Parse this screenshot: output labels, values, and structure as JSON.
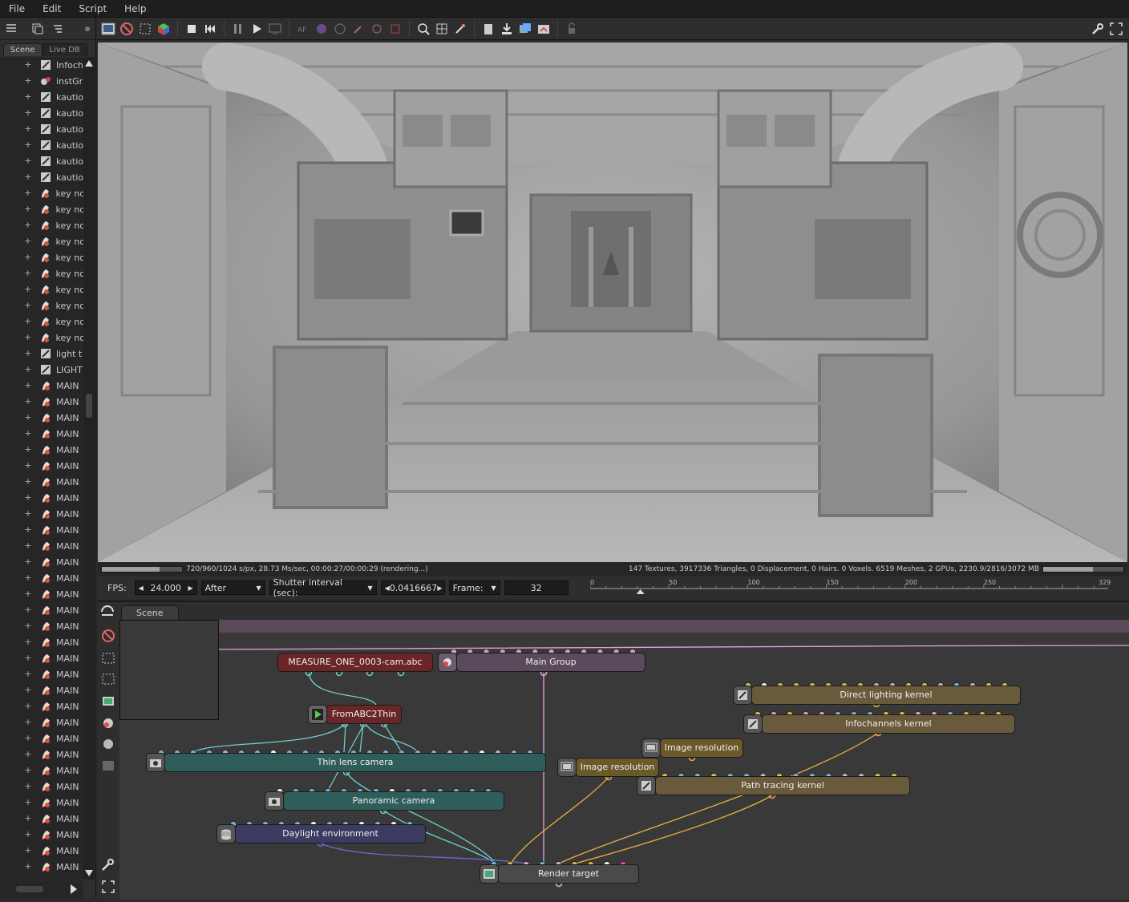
{
  "menu": [
    "File",
    "Edit",
    "Script",
    "Help"
  ],
  "left_panel": {
    "tabs": [
      "Scene",
      "Live DB"
    ],
    "tree": [
      {
        "label": "Infoch",
        "icon": "kernel-icon"
      },
      {
        "label": "instGr",
        "icon": "geometry-icon"
      },
      {
        "label": "kautio",
        "icon": "kernel-icon"
      },
      {
        "label": "kautio",
        "icon": "kernel-icon"
      },
      {
        "label": "kautio",
        "icon": "kernel-icon"
      },
      {
        "label": "kautio",
        "icon": "kernel-icon"
      },
      {
        "label": "kautio",
        "icon": "kernel-icon"
      },
      {
        "label": "kautio",
        "icon": "kernel-icon"
      },
      {
        "label": "key no",
        "icon": "material-icon"
      },
      {
        "label": "key no",
        "icon": "material-icon"
      },
      {
        "label": "key no",
        "icon": "material-icon"
      },
      {
        "label": "key no",
        "icon": "material-icon"
      },
      {
        "label": "key no",
        "icon": "material-icon"
      },
      {
        "label": "key no",
        "icon": "material-icon"
      },
      {
        "label": "key no",
        "icon": "material-icon"
      },
      {
        "label": "key no",
        "icon": "material-icon"
      },
      {
        "label": "key no",
        "icon": "material-icon"
      },
      {
        "label": "key no",
        "icon": "material-icon"
      },
      {
        "label": "light t",
        "icon": "kernel-icon"
      },
      {
        "label": "LIGHT",
        "icon": "kernel-icon"
      },
      {
        "label": "MAIN",
        "icon": "material-icon"
      },
      {
        "label": "MAIN",
        "icon": "material-icon"
      },
      {
        "label": "MAIN",
        "icon": "material-icon"
      },
      {
        "label": "MAIN",
        "icon": "material-icon"
      },
      {
        "label": "MAIN",
        "icon": "material-icon"
      },
      {
        "label": "MAIN",
        "icon": "material-icon"
      },
      {
        "label": "MAIN",
        "icon": "material-icon"
      },
      {
        "label": "MAIN",
        "icon": "material-icon"
      },
      {
        "label": "MAIN",
        "icon": "material-icon"
      },
      {
        "label": "MAIN",
        "icon": "material-icon"
      },
      {
        "label": "MAIN",
        "icon": "material-icon"
      },
      {
        "label": "MAIN",
        "icon": "material-icon"
      },
      {
        "label": "MAIN",
        "icon": "material-icon"
      },
      {
        "label": "MAIN",
        "icon": "material-icon"
      },
      {
        "label": "MAIN",
        "icon": "material-icon"
      },
      {
        "label": "MAIN",
        "icon": "material-icon"
      },
      {
        "label": "MAIN",
        "icon": "material-icon"
      },
      {
        "label": "MAIN",
        "icon": "material-icon"
      },
      {
        "label": "MAIN",
        "icon": "material-icon"
      },
      {
        "label": "MAIN",
        "icon": "material-icon"
      },
      {
        "label": "MAIN",
        "icon": "material-icon"
      },
      {
        "label": "MAIN",
        "icon": "material-icon"
      },
      {
        "label": "MAIN",
        "icon": "material-icon"
      },
      {
        "label": "MAIN",
        "icon": "material-icon"
      },
      {
        "label": "MAIN",
        "icon": "material-icon"
      },
      {
        "label": "MAIN",
        "icon": "material-icon"
      },
      {
        "label": "MAIN",
        "icon": "material-icon"
      },
      {
        "label": "MAIN",
        "icon": "material-icon"
      },
      {
        "label": "MAIN",
        "icon": "material-icon"
      },
      {
        "label": "MAIN",
        "icon": "material-icon"
      },
      {
        "label": "MAIN",
        "icon": "material-icon"
      }
    ]
  },
  "status": {
    "render_progress": 0.72,
    "gpu_progress": 0.62,
    "left_text": "720/960/1024 s/px, 28.73 Ms/sec, 00:00:27/00:00:29 (rendering...)",
    "right_text": "147 Textures, 3917336 Triangles, 0 Displacement, 0 Hairs. 0 Voxels. 6519 Meshes, 2 GPUs, 2230.9/2816/3072 MB"
  },
  "timeline": {
    "fps_label": "FPS:",
    "fps_value": "24.000",
    "after_mode": "After",
    "shutter_label": "Shutter interval (sec):",
    "shutter_value": "0.0416667",
    "frame_label": "Frame:",
    "frame_value": "32",
    "ruler_ticks": [
      "0",
      "50",
      "100",
      "150",
      "200",
      "250",
      "329"
    ],
    "current_frame_fraction": 0.097
  },
  "node_graph": {
    "tab": "Scene",
    "nodes": {
      "measure": "MEASURE_ONE_0003-cam.abc",
      "main_group": "Main Group",
      "fromabc": "FromABC2Thin",
      "thin_lens": "Thin lens camera",
      "panoramic": "Panoramic camera",
      "daylight": "Daylight environment",
      "render_target": "Render target",
      "direct_lighting": "Direct lighting kernel",
      "infochannels": "Infochannels kernel",
      "image_res_1": "Image resolution",
      "image_res_2": "Image resolution",
      "path_tracing": "Path tracing kernel"
    }
  },
  "colors": {
    "camera_node": "#2f5e5a",
    "kernel_node": "#6a5a3c",
    "group_node": "#5a4a5c",
    "env_node": "#3c3c62",
    "geo_node": "#6a2626",
    "pin_teal": "#6fcfc8",
    "pin_orange": "#e8b040",
    "pin_pink": "#e8a0e0"
  }
}
